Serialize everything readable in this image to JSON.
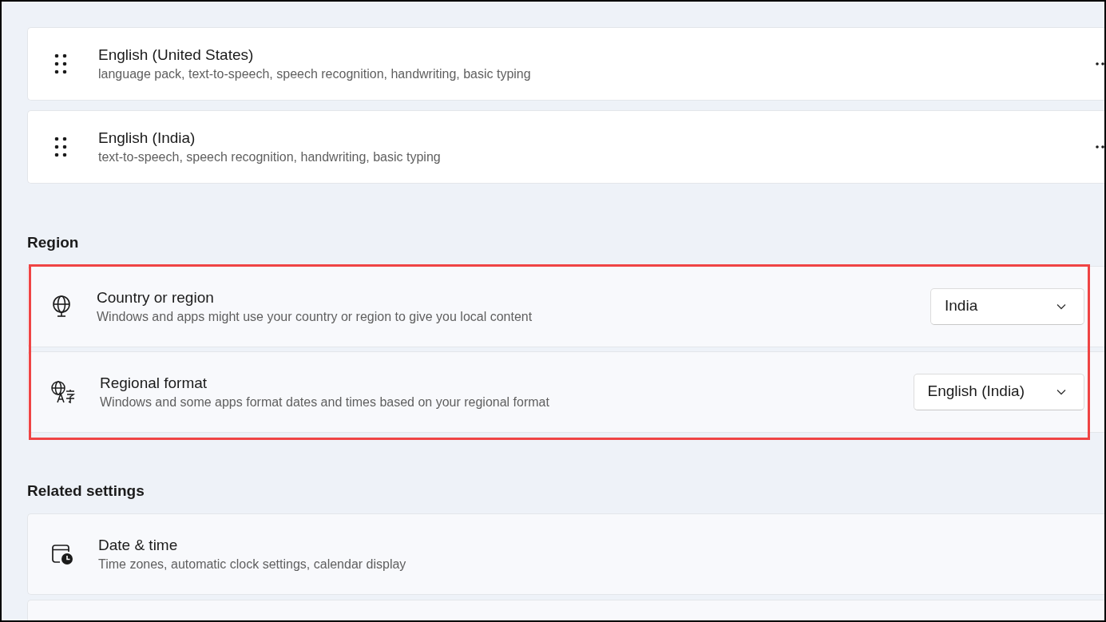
{
  "languages": [
    {
      "name": "English (United States)",
      "features": "language pack, text-to-speech, speech recognition, handwriting, basic typing"
    },
    {
      "name": "English (India)",
      "features": "text-to-speech, speech recognition, handwriting, basic typing"
    }
  ],
  "region": {
    "heading": "Region",
    "highlighted": true,
    "settings": [
      {
        "title": "Country or region",
        "description": "Windows and apps might use your country or region to give you local content",
        "value": "India"
      },
      {
        "title": "Regional format",
        "description": "Windows and some apps format dates and times based on your regional format",
        "value": "English (India)"
      }
    ]
  },
  "related_settings": {
    "heading": "Related settings",
    "items": [
      {
        "title": "Date & time",
        "description": "Time zones, automatic clock settings, calendar display"
      }
    ]
  }
}
